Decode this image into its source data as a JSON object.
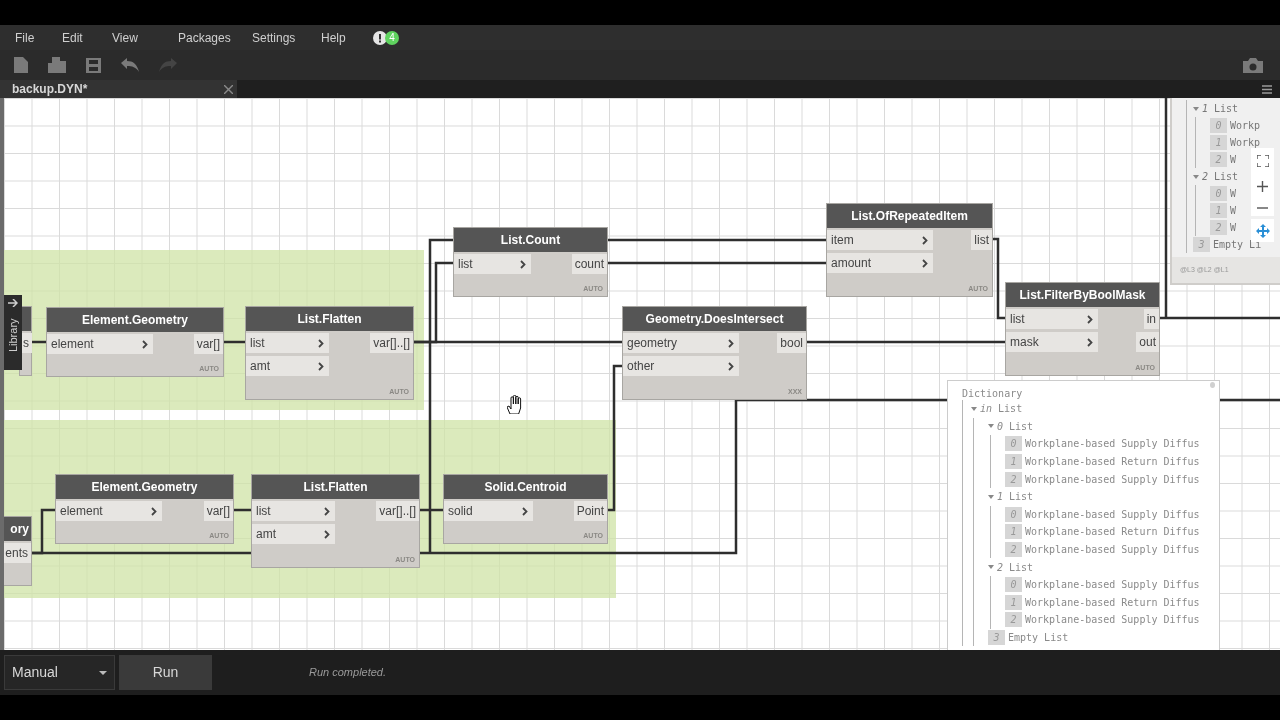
{
  "menu": [
    {
      "label": "File"
    },
    {
      "label": "Edit"
    },
    {
      "label": "View"
    },
    {
      "label": "Packages"
    },
    {
      "label": "Settings"
    },
    {
      "label": "Help"
    }
  ],
  "notifications": {
    "count": "4"
  },
  "tab": {
    "title": "backup.DYN*"
  },
  "library_tab": {
    "label": "Library"
  },
  "nodes": [
    {
      "outputs": [
        "s"
      ]
    },
    {
      "title": "Element.Geometry",
      "inputs": [
        "element"
      ],
      "outputs": [
        "var[]"
      ],
      "lacing": "AUTO"
    },
    {
      "title": "List.Flatten",
      "inputs": [
        "list",
        "amt"
      ],
      "outputs": [
        "var[]..[]"
      ],
      "lacing": "AUTO"
    },
    {
      "title": "List.Count",
      "inputs": [
        "list"
      ],
      "outputs": [
        "count"
      ],
      "lacing": "AUTO"
    },
    {
      "title": "Geometry.DoesIntersect",
      "inputs": [
        "geometry",
        "other"
      ],
      "outputs": [
        "bool"
      ],
      "lacing": "XXX"
    },
    {
      "title": "List.OfRepeatedItem",
      "inputs": [
        "item",
        "amount"
      ],
      "outputs": [
        "list"
      ],
      "lacing": "AUTO"
    },
    {
      "title": "List.FilterByBoolMask",
      "inputs": [
        "list",
        "mask"
      ],
      "outputs": [
        "in",
        "out"
      ],
      "lacing": "AUTO"
    },
    {
      "title": "ory",
      "outputs": [
        "ents"
      ]
    },
    {
      "title": "Element.Geometry",
      "inputs": [
        "element"
      ],
      "outputs": [
        "var[]"
      ],
      "lacing": "AUTO"
    },
    {
      "title": "List.Flatten",
      "inputs": [
        "list",
        "amt"
      ],
      "outputs": [
        "var[]..[]"
      ],
      "lacing": "AUTO"
    },
    {
      "title": "Solid.Centroid",
      "inputs": [
        "solid"
      ],
      "outputs": [
        "Point"
      ],
      "lacing": "AUTO"
    }
  ],
  "watch_top": {
    "items": [
      {
        "index": "1",
        "label": "List",
        "expanded": true,
        "children": [
          {
            "index": "0",
            "label": "Workp"
          },
          {
            "index": "1",
            "label": "Workp"
          },
          {
            "index": "2",
            "label": "W"
          }
        ]
      },
      {
        "index": "2",
        "label": "List",
        "expanded": true,
        "children": [
          {
            "index": "0",
            "label": "W"
          },
          {
            "index": "1",
            "label": "W"
          },
          {
            "index": "2",
            "label": "W"
          }
        ]
      },
      {
        "index": "3",
        "label": "Empty Li"
      }
    ],
    "levels": "@L3 @L2 @L1"
  },
  "watch": {
    "title": "Dictionary",
    "items": [
      {
        "index": "in",
        "label": "List",
        "expanded": true,
        "children": [
          {
            "index": "0",
            "label": "List",
            "expanded": true,
            "children": [
              {
                "index": "0",
                "label": "Workplane-based Supply Diffus"
              },
              {
                "index": "1",
                "label": "Workplane-based Return Diffus"
              },
              {
                "index": "2",
                "label": "Workplane-based Supply Diffus"
              }
            ]
          },
          {
            "index": "1",
            "label": "List",
            "expanded": true,
            "children": [
              {
                "index": "0",
                "label": "Workplane-based Supply Diffus"
              },
              {
                "index": "1",
                "label": "Workplane-based Return Diffus"
              },
              {
                "index": "2",
                "label": "Workplane-based Supply Diffus"
              }
            ]
          },
          {
            "index": "2",
            "label": "List",
            "expanded": true,
            "children": [
              {
                "index": "0",
                "label": "Workplane-based Supply Diffus"
              },
              {
                "index": "1",
                "label": "Workplane-based Return Diffus"
              },
              {
                "index": "2",
                "label": "Workplane-based Supply Diffus"
              }
            ]
          },
          {
            "index": "3",
            "label": "Empty List"
          }
        ]
      }
    ]
  },
  "run": {
    "mode": "Manual",
    "button": "Run",
    "status": "Run completed."
  }
}
